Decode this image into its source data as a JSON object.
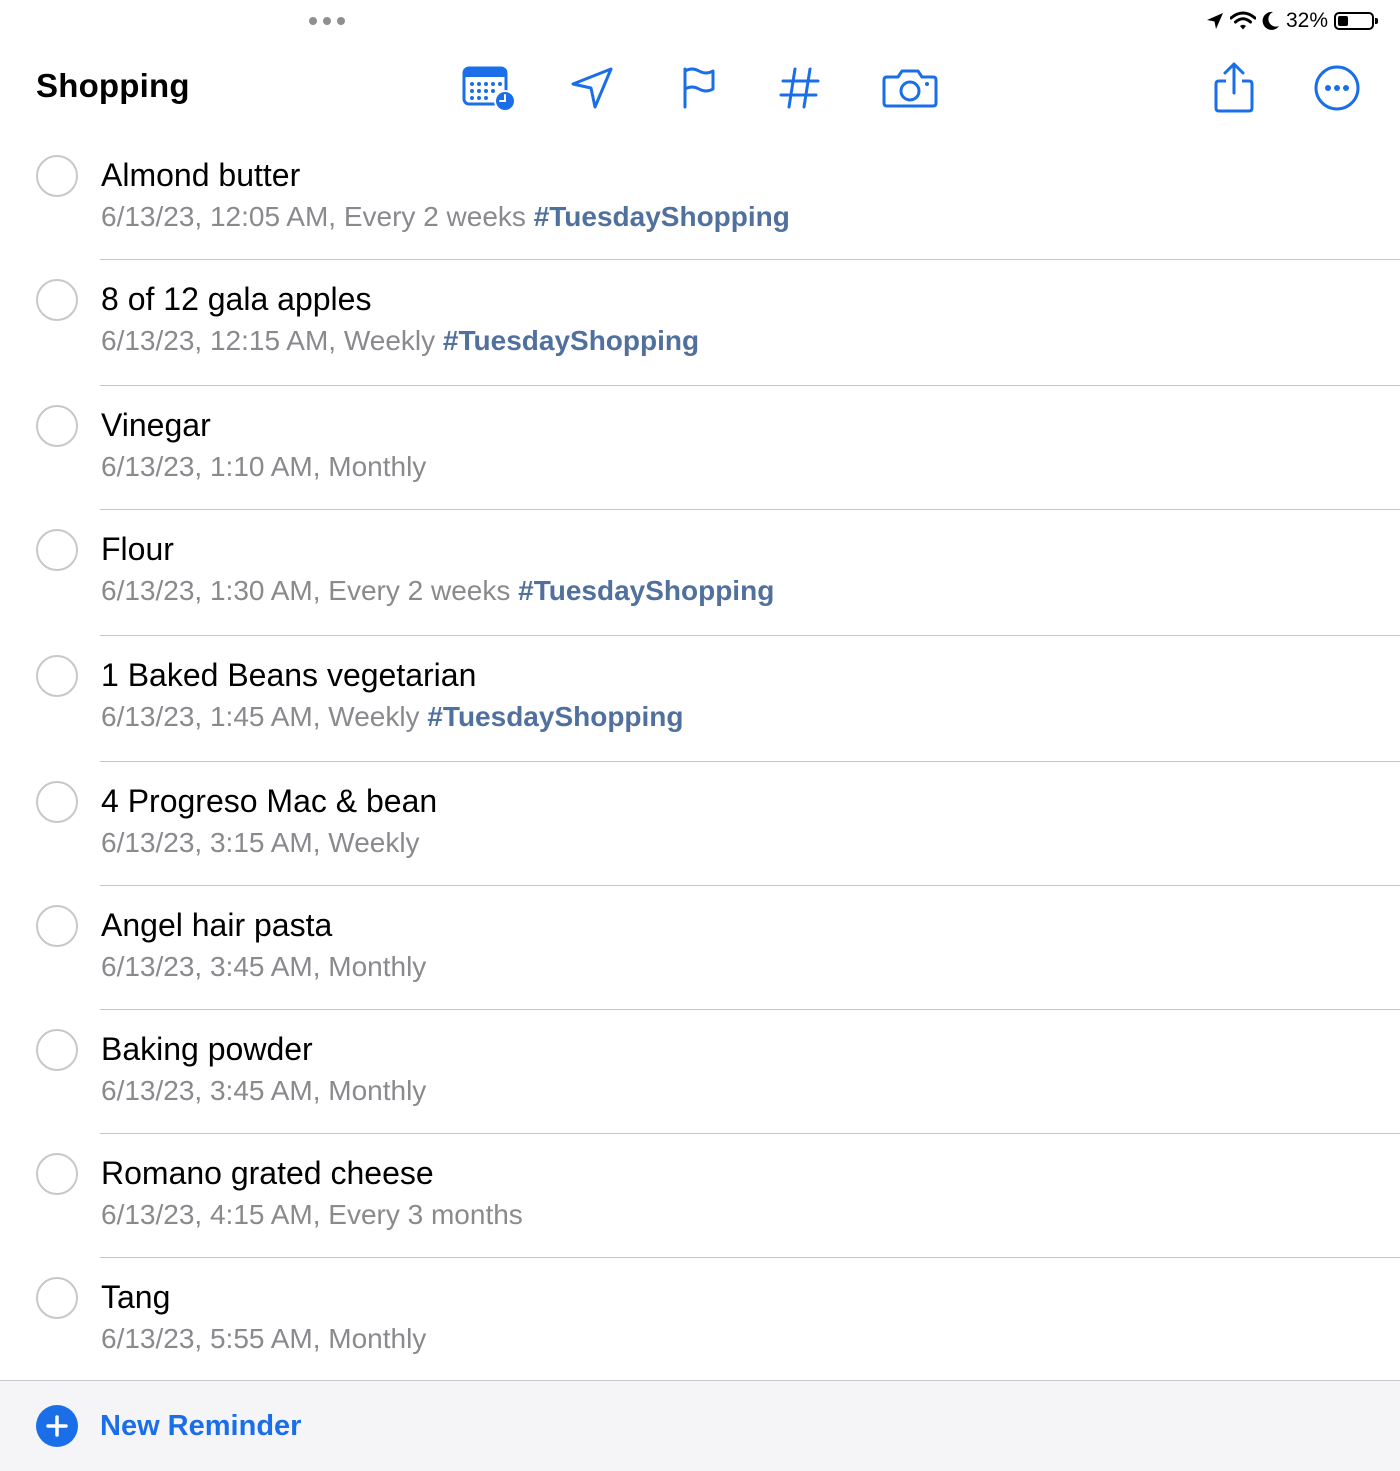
{
  "status_bar": {
    "battery_text": "32%",
    "battery_level": 0.32
  },
  "toolbar": {
    "title": "Shopping",
    "icons": [
      "calendar-clock-icon",
      "location-arrow-icon",
      "flag-icon",
      "hashtag-icon",
      "camera-icon",
      "share-icon",
      "more-icon"
    ]
  },
  "colors": {
    "accent": "#1a6fe8",
    "tag": "#50709e",
    "secondary_text": "#8a8a8e"
  },
  "reminders": [
    {
      "title": "Almond butter",
      "detail": "6/13/23, 12:05 AM, Every 2 weeks",
      "tag": "#TuesdayShopping"
    },
    {
      "title": "8 of 12 gala apples",
      "detail": "6/13/23, 12:15 AM, Weekly",
      "tag": "#TuesdayShopping"
    },
    {
      "title": "Vinegar",
      "detail": "6/13/23, 1:10 AM, Monthly",
      "tag": ""
    },
    {
      "title": "Flour",
      "detail": "6/13/23, 1:30 AM, Every 2 weeks",
      "tag": "#TuesdayShopping"
    },
    {
      "title": "1 Baked Beans vegetarian",
      "detail": "6/13/23, 1:45 AM, Weekly",
      "tag": "#TuesdayShopping"
    },
    {
      "title": "4 Progreso Mac & bean",
      "detail": "6/13/23, 3:15 AM, Weekly",
      "tag": ""
    },
    {
      "title": "Angel hair pasta",
      "detail": "6/13/23, 3:45 AM, Monthly",
      "tag": ""
    },
    {
      "title": "Baking powder",
      "detail": "6/13/23, 3:45 AM, Monthly",
      "tag": ""
    },
    {
      "title": "Romano grated cheese",
      "detail": "6/13/23, 4:15 AM, Every 3 months",
      "tag": ""
    },
    {
      "title": "Tang",
      "detail": "6/13/23, 5:55 AM, Monthly",
      "tag": ""
    }
  ],
  "footer": {
    "new_reminder_label": "New Reminder"
  }
}
